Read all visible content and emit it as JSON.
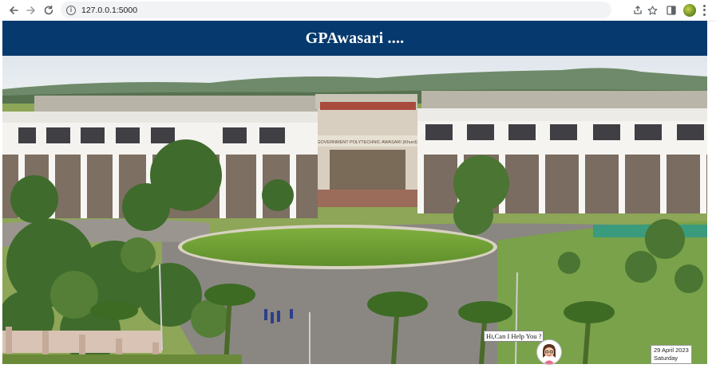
{
  "browser": {
    "url": "127.0.0.1:5000",
    "icons": {
      "back": "back-arrow-icon",
      "forward": "forward-arrow-icon",
      "reload": "reload-icon",
      "info": "site-info-icon",
      "share": "share-icon",
      "bookmark": "star-icon",
      "sidepanel": "side-panel-icon",
      "profile": "profile-avatar",
      "menu": "kebab-menu-icon"
    }
  },
  "header": {
    "title": "GPAwasari ....",
    "background": "#063a6e"
  },
  "hero": {
    "building_sign": "GOVERNMENT POLYTECHNIC AWASARI (Khurd)"
  },
  "chat": {
    "prompt": "Hi,Can I Help You ?"
  },
  "date_widget": {
    "date": "29 April 2023",
    "day": "Saturday"
  }
}
